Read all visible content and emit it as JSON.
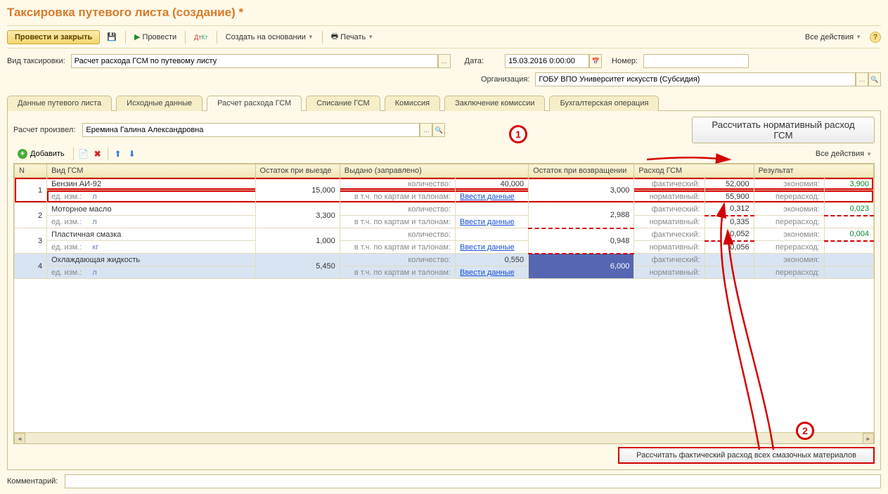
{
  "title": "Таксировка путевого листа (создание) *",
  "toolbar": {
    "submit_close": "Провести и закрыть",
    "submit": "Провести",
    "create_based": "Создать на основании",
    "print": "Печать",
    "all_actions": "Все действия"
  },
  "form": {
    "taxType_label": "Вид таксировки:",
    "taxType_value": "Расчет расхода ГСМ по путевому листу",
    "date_label": "Дата:",
    "date_value": "15.03.2016 0:00:00",
    "number_label": "Номер:",
    "number_value": "",
    "org_label": "Организация:",
    "org_value": "ГОБУ ВПО Университет искусств (Субсидия)"
  },
  "tabs": [
    {
      "id": "tab-route-data",
      "label": "Данные путевого листа"
    },
    {
      "id": "tab-source-data",
      "label": "Исходные данные"
    },
    {
      "id": "tab-fuel-calc",
      "label": "Расчет расхода ГСМ",
      "active": true
    },
    {
      "id": "tab-writeoff",
      "label": "Списание ГСМ"
    },
    {
      "id": "tab-commission",
      "label": "Комиссия"
    },
    {
      "id": "tab-conclusion",
      "label": "Заключение комиссии"
    },
    {
      "id": "tab-accounting",
      "label": "Бухгалтерская операция"
    }
  ],
  "calc": {
    "made_by_label": "Расчет произвел:",
    "made_by_value": "Еремина Галина Александровна",
    "calc_norm_btn": "Рассчитать нормативный расход ГСМ",
    "all_actions": "Все действия",
    "add_btn": "Добавить"
  },
  "grid": {
    "headers": {
      "n": "N",
      "type": "Вид ГСМ",
      "rest_out": "Остаток при выезде",
      "issued": "Выдано (заправлено)",
      "rest_back": "Остаток при возвращении",
      "consumption": "Расход ГСМ",
      "result": "Результат"
    },
    "labels": {
      "unit": "ед. изм.:",
      "qty": "количество:",
      "cards": "в т.ч. по картам и талонам:",
      "enter_data": "Ввести данные",
      "actual": "фактический:",
      "normative": "нормативный:",
      "economy": "экономия:",
      "overrun": "перерасход:"
    },
    "rows": [
      {
        "n": "1",
        "name": "Бензин АИ-92",
        "unit": "л",
        "rest_out": "15,000",
        "qty": "40,000",
        "rest_back": "3,000",
        "actual": "52,000",
        "norm": "55,900",
        "eco": "3,900",
        "over": ""
      },
      {
        "n": "2",
        "name": "Моторное масло",
        "unit": "л",
        "rest_out": "3,300",
        "qty": "",
        "rest_back": "2,988",
        "actual": "0,312",
        "norm": "0,335",
        "eco": "0,023",
        "over": ""
      },
      {
        "n": "3",
        "name": "Пластичная смазка",
        "unit": "кг",
        "rest_out": "1,000",
        "qty": "",
        "rest_back": "0,948",
        "actual": "0,052",
        "norm": "0,056",
        "eco": "0,004",
        "over": ""
      },
      {
        "n": "4",
        "name": "Охлаждающая жидкость",
        "unit": "л",
        "rest_out": "5,450",
        "qty": "0,550",
        "rest_back": "6,000",
        "actual": "",
        "norm": "",
        "eco": "",
        "over": ""
      }
    ]
  },
  "bottom_btn": "Рассчитать фактический расход всех смазочных материалов",
  "comment_label": "Комментарий:",
  "comment_value": "",
  "annotations": {
    "a1": "1",
    "a2": "2"
  }
}
